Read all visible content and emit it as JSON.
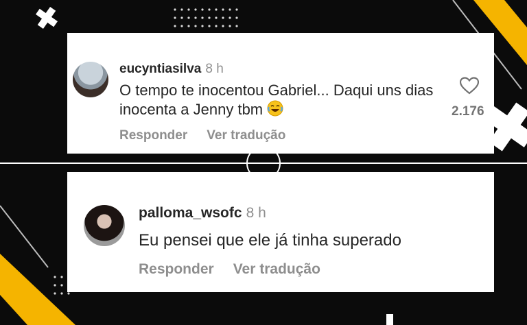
{
  "comments": [
    {
      "username": "eucyntiasilva",
      "time": "8 h",
      "text": "O tempo te inocentou Gabriel... Daqui uns dias inocenta a Jenny tbm",
      "emoji": "laughing-face",
      "reply_label": "Responder",
      "translate_label": "Ver tradução",
      "likes": "2.176"
    },
    {
      "username": "palloma_wsofc",
      "time": "8 h",
      "text": "Eu pensei que ele já tinha superado",
      "reply_label": "Responder",
      "translate_label": "Ver tradução"
    }
  ],
  "colors": {
    "background": "#0b0b0b",
    "accent": "#f5b400",
    "card": "#ffffff"
  }
}
